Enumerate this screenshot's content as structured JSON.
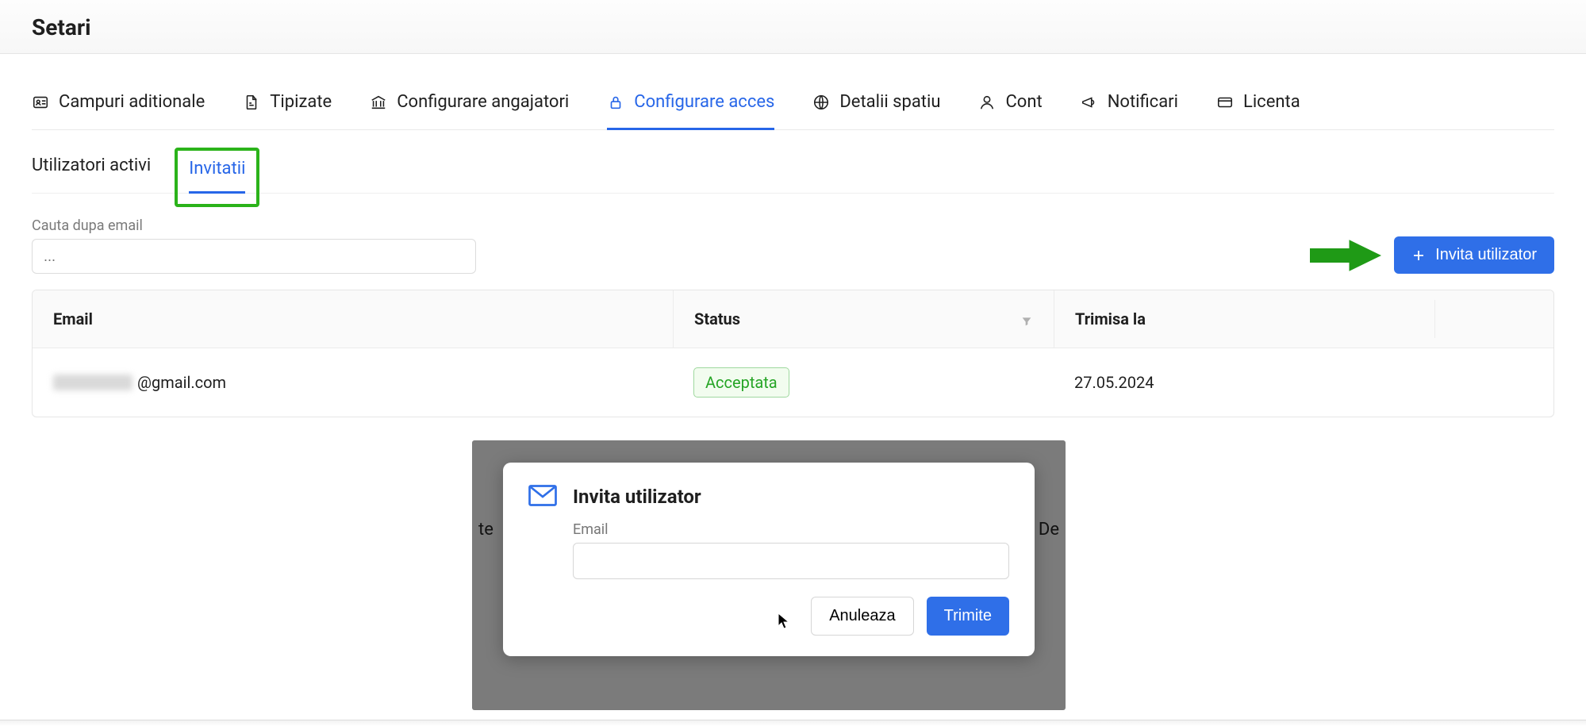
{
  "page": {
    "title": "Setari"
  },
  "tabs_primary": {
    "campuri": "Campuri aditionale",
    "tipizate": "Tipizate",
    "angajatori": "Configurare angajatori",
    "acces": "Configurare acces",
    "spatiu": "Detalii spatiu",
    "cont": "Cont",
    "notificari": "Notificari",
    "licenta": "Licenta"
  },
  "tabs_secondary": {
    "activi": "Utilizatori activi",
    "invitatii": "Invitatii"
  },
  "search": {
    "label": "Cauta dupa email",
    "placeholder": "..."
  },
  "buttons": {
    "invite": "Invita utilizator"
  },
  "table": {
    "headers": {
      "email": "Email",
      "status": "Status",
      "sent_at": "Trimisa la"
    },
    "rows": [
      {
        "email_suffix": "@gmail.com",
        "status": "Acceptata",
        "sent_at": "27.05.2024"
      }
    ]
  },
  "modal": {
    "title": "Invita utilizator",
    "email_label": "Email",
    "cancel": "Anuleaza",
    "send": "Trimite"
  },
  "overlay_peek": {
    "left": "te",
    "right": "De"
  }
}
